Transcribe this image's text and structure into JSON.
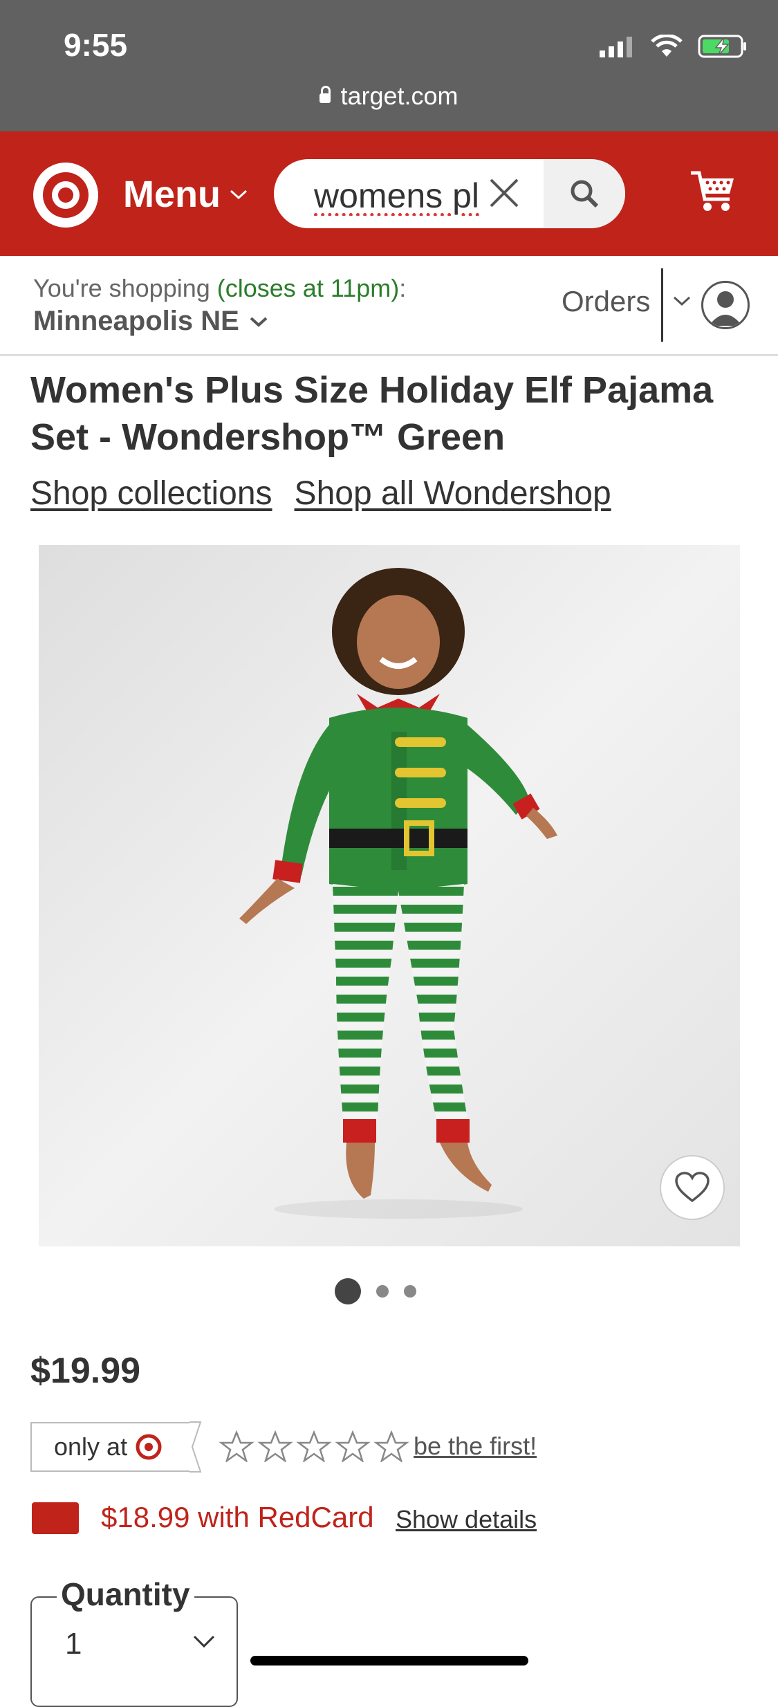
{
  "status_bar": {
    "time": "9:55",
    "url": "target.com"
  },
  "header": {
    "menu_label": "Menu",
    "search_value": "womens pl",
    "brand_color": "#c0231a"
  },
  "store": {
    "shopping_prefix": "You're shopping ",
    "hours": "(closes at 11pm)",
    "colon": ":",
    "name": "Minneapolis NE",
    "orders_label": "Orders"
  },
  "product": {
    "title": "Women's Plus Size Holiday Elf Pajama Set - Wondershop™ Green",
    "link_collections": "Shop collections",
    "link_brand": "Shop all Wondershop",
    "image_count": 3,
    "active_image": 1,
    "price": "$19.99",
    "only_at_label": "only at",
    "rating_stars": 0,
    "rating_cta": "be the first!",
    "redcard_price": "$18.99 with RedCard",
    "show_details": "Show details",
    "quantity_label": "Quantity",
    "quantity_value": "1"
  }
}
